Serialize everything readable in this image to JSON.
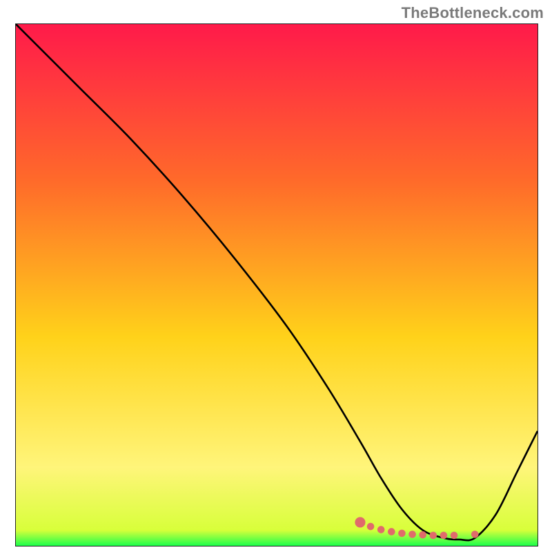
{
  "watermark": {
    "text": "TheBottleneck.com"
  },
  "colors": {
    "gradient_top": "#ff1a4a",
    "gradient_mid1": "#ff6a2a",
    "gradient_mid2": "#ffd21a",
    "gradient_mid3": "#fff57a",
    "gradient_bottom": "#1cff4a",
    "curve": "#000000",
    "marker": "#e06b6b"
  },
  "chart_data": {
    "type": "line",
    "title": "",
    "xlabel": "",
    "ylabel": "",
    "xlim": [
      0,
      100
    ],
    "ylim": [
      0,
      100
    ],
    "series": [
      {
        "name": "bottleneck-curve",
        "x": [
          0,
          12,
          22,
          32,
          42,
          52,
          60,
          66,
          70,
          74,
          78,
          82,
          85,
          88,
          92,
          96,
          100
        ],
        "y": [
          100,
          88,
          78,
          67,
          55,
          42,
          30,
          20,
          13,
          7,
          3,
          1.5,
          1.2,
          1.5,
          6,
          14,
          22
        ]
      }
    ],
    "markers": {
      "name": "highlight-points",
      "x": [
        66,
        68,
        70,
        72,
        74,
        76,
        78,
        80,
        82,
        84,
        88
      ],
      "y": [
        4.5,
        3.7,
        3.1,
        2.7,
        2.4,
        2.2,
        2.1,
        2.0,
        2.0,
        2.0,
        2.2
      ]
    },
    "background": {
      "type": "vertical-gradient",
      "stops": [
        {
          "pos": 0.0,
          "color": "#ff1a4a"
        },
        {
          "pos": 0.3,
          "color": "#ff6a2a"
        },
        {
          "pos": 0.6,
          "color": "#ffd21a"
        },
        {
          "pos": 0.85,
          "color": "#fff57a"
        },
        {
          "pos": 0.97,
          "color": "#d8ff3a"
        },
        {
          "pos": 1.0,
          "color": "#1cff4a"
        }
      ]
    }
  }
}
